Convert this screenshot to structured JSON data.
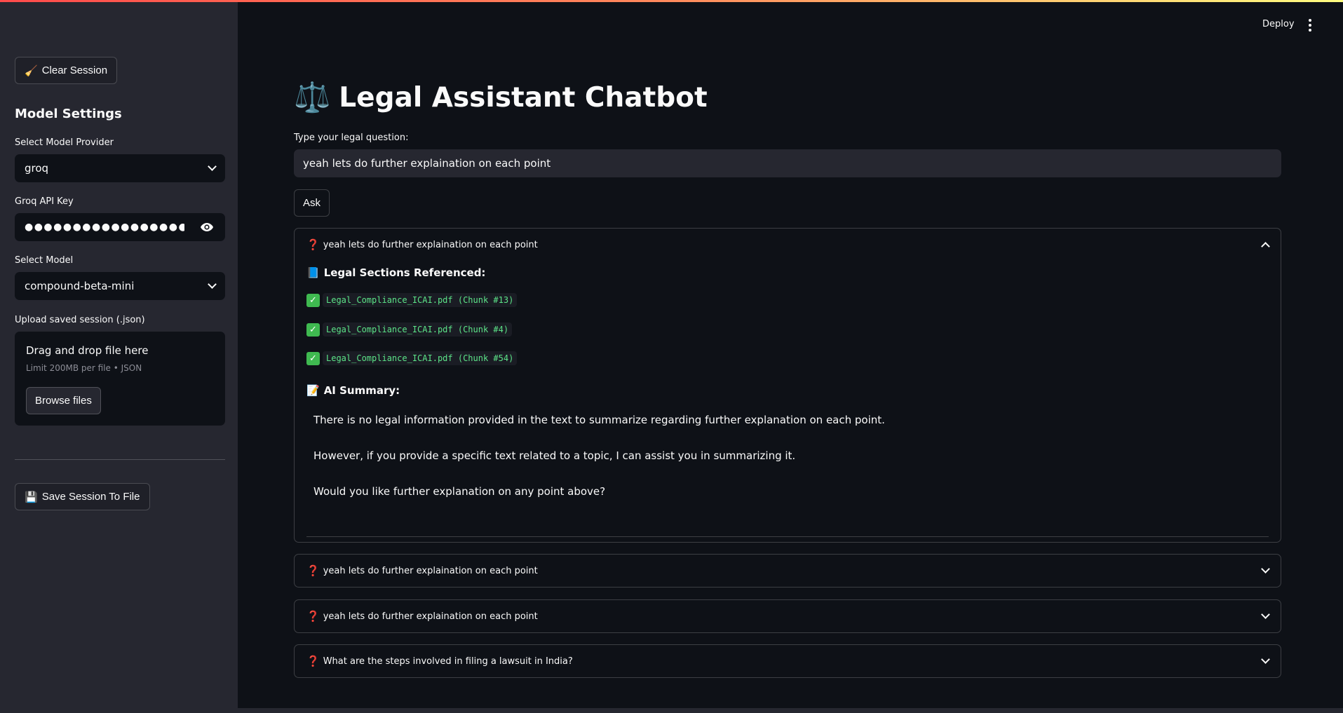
{
  "sidebar": {
    "clear_button": {
      "icon": "🧹",
      "label": "Clear Session"
    },
    "settings_title": "Model Settings",
    "provider": {
      "label": "Select Model Provider",
      "value": "groq"
    },
    "api_key": {
      "label": "Groq API Key",
      "masked_value": "●●●●●●●●●●●●●●●●●●●●●●●●●●●●"
    },
    "model": {
      "label": "Select Model",
      "value": "compound-beta-mini"
    },
    "upload": {
      "label": "Upload saved session (.json)",
      "drop_text": "Drag and drop file here",
      "limit_text": "Limit 200MB per file • JSON",
      "browse_label": "Browse files"
    },
    "save_button": {
      "icon": "💾",
      "label": "Save Session To File"
    }
  },
  "header": {
    "deploy_label": "Deploy"
  },
  "main": {
    "title_icon": "⚖️",
    "title": "Legal Assistant Chatbot",
    "question_label": "Type your legal question:",
    "question_value": "yeah lets do further explaination on each point",
    "ask_label": "Ask",
    "expanders": [
      {
        "icon": "❓",
        "question": "yeah lets do further explaination on each point",
        "expanded": true,
        "sections_icon": "📘",
        "sections_title": "Legal Sections Referenced:",
        "references": [
          "Legal_Compliance_ICAI.pdf (Chunk #13)",
          "Legal_Compliance_ICAI.pdf (Chunk #4)",
          "Legal_Compliance_ICAI.pdf (Chunk #54)"
        ],
        "check_glyph": "✓",
        "summary_icon": "📝",
        "summary_title": "AI Summary:",
        "summary_paragraphs": [
          "There is no legal information provided in the text to summarize regarding further explanation on each point.",
          "However, if you provide a specific text related to a topic, I can assist you in summarizing it.",
          "Would you like further explanation on any point above?"
        ]
      },
      {
        "icon": "❓",
        "question": "yeah lets do further explaination on each point",
        "expanded": false
      },
      {
        "icon": "❓",
        "question": "yeah lets do further explaination on each point",
        "expanded": false
      },
      {
        "icon": "❓",
        "question": "What are the steps involved in filing a lawsuit in India?",
        "expanded": false
      }
    ]
  }
}
